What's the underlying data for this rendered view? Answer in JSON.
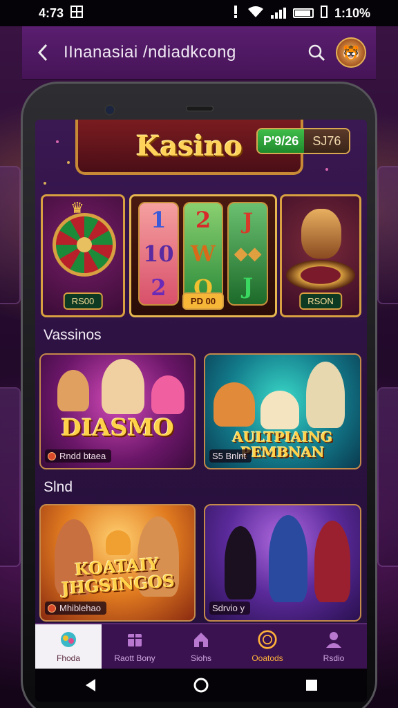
{
  "status_bar": {
    "time_left": "4:73",
    "time_right": "1:10%"
  },
  "app_bar": {
    "title": "IInanasiai /ndiadkcong"
  },
  "banner": {
    "title": "Kasino",
    "balance_green": "P'9/26",
    "balance_dark": "SJ76"
  },
  "slots": [
    {
      "label": "RS00"
    },
    {
      "label": "PD 00"
    },
    {
      "label": "RSON"
    }
  ],
  "reels": {
    "reel1": [
      "1",
      "10",
      "2"
    ],
    "reel2": [
      "2",
      "W",
      "O"
    ],
    "reel3": [
      "J",
      "",
      "J"
    ]
  },
  "sections": {
    "first": "Vassinos",
    "second": "Slnd"
  },
  "games": [
    {
      "title": "DIASMO",
      "caption": "Rndd btaea"
    },
    {
      "title": "AULTPIAING PEMBNAN",
      "caption": "S5 Bnlnt"
    },
    {
      "title": "KOATAIY JHGSINGOS",
      "caption": "Mhiblehao"
    },
    {
      "title": "",
      "caption": "Sdrvio y"
    }
  ],
  "bottom_nav": [
    {
      "label": "Fhoda",
      "icon": "game-controller-icon"
    },
    {
      "label": "Raott Bony",
      "icon": "gift-box-icon"
    },
    {
      "label": "Siohs",
      "icon": "home-icon"
    },
    {
      "label": "Ooatods",
      "icon": "casino-chip-icon"
    },
    {
      "label": "Rsdio",
      "icon": "profile-icon"
    }
  ],
  "colors": {
    "accent_gold": "#ffd24a",
    "nav_bar": "#3a1250",
    "app_bar": "#5a1e70",
    "active_tab": "#f4f1f6",
    "highlight_orange": "#ffb23a"
  }
}
